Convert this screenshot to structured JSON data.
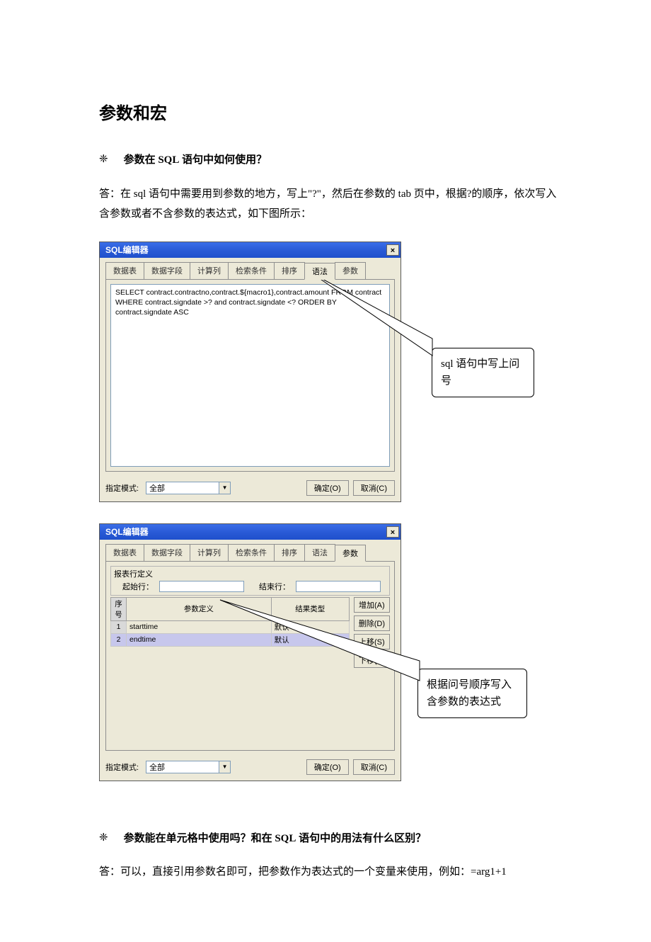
{
  "page_title": "参数和宏",
  "q1": {
    "bullet": "❈",
    "text_pre": "参数在 ",
    "text_mid": "SQL",
    "text_post": " 语句中如何使用？"
  },
  "a1": "答：在 sql 语句中需要用到参数的地方，写上\"?\"，然后在参数的 tab 页中，根据?的顺序，依次写入含参数或者不含参数的表达式，如下图所示：",
  "dialog1": {
    "title": "SQL编辑器",
    "close": "×",
    "tabs": [
      "数据表",
      "数据字段",
      "计算列",
      "检索条件",
      "排序",
      "语法",
      "参数"
    ],
    "active_tab_index": 5,
    "sql": "SELECT contract.contractno,contract.${macro1},contract.amount FROM contract WHERE contract.signdate >? and  contract.signdate <? ORDER BY contract.signdate ASC",
    "mode_label": "指定模式:",
    "mode_value": "全部",
    "ok": "确定(O)",
    "cancel": "取消(C)"
  },
  "callout1": "sql 语句中写上问号",
  "dialog2": {
    "title": "SQL编辑器",
    "close": "×",
    "tabs": [
      "数据表",
      "数据字段",
      "计算列",
      "检索条件",
      "排序",
      "语法",
      "参数"
    ],
    "active_tab_index": 6,
    "rowdef_title": "报表行定义",
    "start_label": "起始行：",
    "end_label": "结束行：",
    "col_seq": "序号",
    "col_def": "参数定义",
    "col_type": "结果类型",
    "rows": [
      {
        "n": "1",
        "def": "starttime",
        "type": "默认"
      },
      {
        "n": "2",
        "def": "endtime",
        "type": "默认"
      }
    ],
    "btn_add": "增加(A)",
    "btn_del": "删除(D)",
    "btn_up": "上移(S)",
    "btn_down": "下移(X)",
    "mode_label": "指定模式:",
    "mode_value": "全部",
    "ok": "确定(O)",
    "cancel": "取消(C)"
  },
  "callout2": "根据问号顺序写入含参数的表达式",
  "q2": {
    "bullet": "❈",
    "text_pre": "参数能在单元格中使用吗？和在 ",
    "text_mid": "SQL",
    "text_post": " 语句中的用法有什么区别？"
  },
  "a2": "答：可以，直接引用参数名即可，把参数作为表达式的一个变量来使用，例如：=arg1+1"
}
